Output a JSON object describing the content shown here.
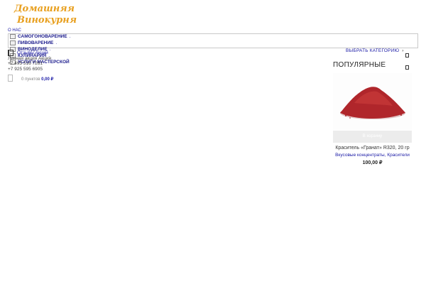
{
  "header": {
    "logo_text": "Домашняя Винокурня",
    "about_link": "О НАС",
    "categories": [
      {
        "label": "САМОГОНОВАРЕНИЕ",
        "dot": "."
      },
      {
        "label": "ПИВОВАРЕНИЕ",
        "dot": "."
      },
      {
        "label": "ВИНОДЕЛИЕ",
        "dot": "."
      },
      {
        "label": "КУЛИНАРИЯ",
        "dot": "."
      },
      {
        "label": "УСЛУГИ МАСТЕРСКОЙ",
        "dot": ""
      }
    ],
    "overlay_links": [
      "Отзывы Акций",
      "Личная акция Акция"
    ],
    "phones": [
      "+7 495 516 7261",
      "+7 925 595 6905"
    ],
    "cart": {
      "items_text": "0 пунктов",
      "sum": "0,00 ₽"
    },
    "select_category": "ВЫБРАТЬ КАТЕГОРИЮ",
    "select_chevron": "›"
  },
  "popular": {
    "title": "ПОПУЛЯРНЫЕ",
    "product": {
      "buy_label": "В корзину",
      "name": "Краситель «Гранат» R320, 20 гр",
      "categories": "Вкусовые концентраты, Красители",
      "price": "100,00 ₽"
    }
  },
  "colors": {
    "link": "#1a1aa6",
    "logo": "#e8a020",
    "powder": "#b0262b"
  }
}
